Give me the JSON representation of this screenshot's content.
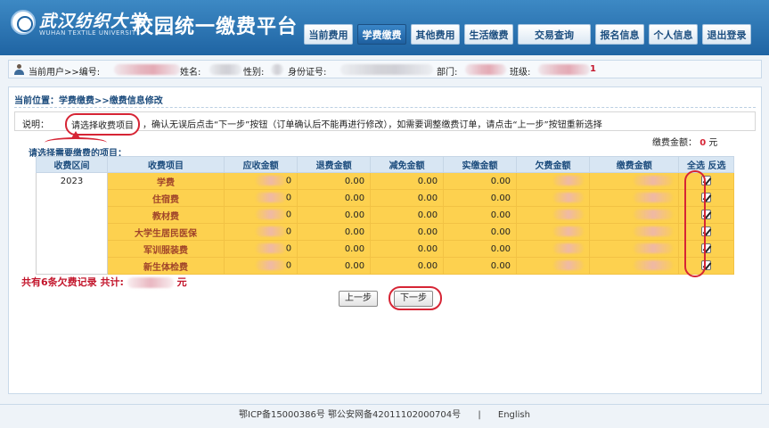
{
  "header": {
    "school_name": "武汉纺织大学",
    "school_name_en": "WUHAN TEXTILE UNIVERSITY",
    "system_title": "校园统一缴费平台",
    "nav": [
      {
        "label": "当前费用",
        "active": false
      },
      {
        "label": "学费缴费",
        "active": true
      },
      {
        "label": "其他费用",
        "active": false
      },
      {
        "label": "生活缴费",
        "active": false
      },
      {
        "label": "交易查询",
        "active": false
      },
      {
        "label": "报名信息",
        "active": false
      },
      {
        "label": "个人信息",
        "active": false
      },
      {
        "label": "退出登录",
        "active": false
      }
    ]
  },
  "userbar": {
    "current_user": "当前用户>>编号:",
    "name_label": "姓名:",
    "gender_label": "性别:",
    "id_label": "身份证号:",
    "dept_label": "部门:",
    "class_label": "班级:",
    "class_tail": "1"
  },
  "page": {
    "location": "当前位置：学费缴费>>缴费信息修改",
    "notice_prefix": "说明：",
    "notice_highlight": "请选择收费项目",
    "notice_rest": "，确认无误后点击“下一步”按钮（订单确认后不能再进行修改），如需要调整缴费订单，请点击“上一步”按钮重新选择",
    "amount_label": "缴费金额：",
    "amount_value": "0",
    "amount_unit": "元",
    "select_title": "请选择需要缴费的项目："
  },
  "table": {
    "headers": [
      "收费区间",
      "收费项目",
      "应收金额",
      "退费金额",
      "减免金额",
      "实缴金额",
      "欠费金额",
      "缴费金额"
    ],
    "select_all": "全选",
    "select_inverse": "反选",
    "year": "2023",
    "rows": [
      {
        "item": "学费",
        "due_tail": "0",
        "refund": "0.00",
        "reduce": "0.00",
        "paid": "0.00",
        "checked": true
      },
      {
        "item": "住宿费",
        "due_tail": "0",
        "refund": "0.00",
        "reduce": "0.00",
        "paid": "0.00",
        "checked": true
      },
      {
        "item": "教材费",
        "due_tail": "0",
        "refund": "0.00",
        "reduce": "0.00",
        "paid": "0.00",
        "checked": true
      },
      {
        "item": "大学生居民医保",
        "due_tail": "0",
        "refund": "0.00",
        "reduce": "0.00",
        "paid": "0.00",
        "checked": true
      },
      {
        "item": "军训服装费",
        "due_tail": "0",
        "refund": "0.00",
        "reduce": "0.00",
        "paid": "0.00",
        "checked": true
      },
      {
        "item": "新生体检费",
        "due_tail": "0",
        "refund": "0.00",
        "reduce": "0.00",
        "paid": "0.00",
        "checked": true
      }
    ]
  },
  "summary": {
    "prefix": "共有6条欠费记录 共计:",
    "suffix": "元"
  },
  "buttons": {
    "prev": "上一步",
    "next": "下一步"
  },
  "footer": {
    "icp": "鄂ICP备15000386号 鄂公安网备42011102000704号",
    "separator": "|",
    "lang": "English"
  },
  "colors": {
    "header": "#1f64a3",
    "row_highlight": "#fdd14f",
    "annotation": "#d62535"
  }
}
